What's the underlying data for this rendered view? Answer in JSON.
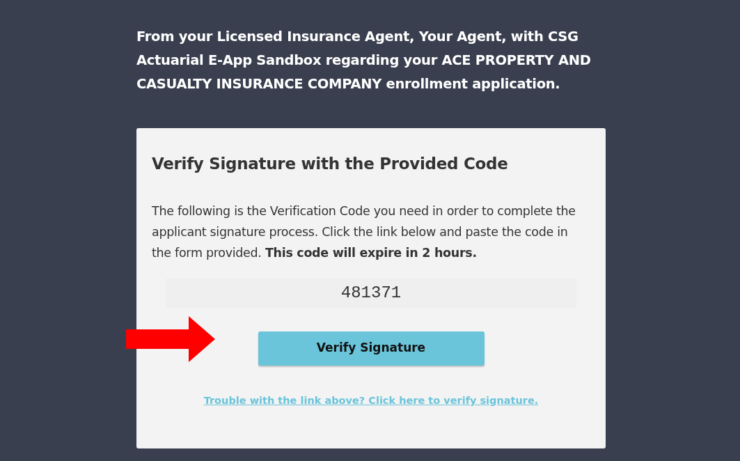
{
  "intro": "From your Licensed Insurance Agent, Your Agent, with CSG Actuarial E-App Sandbox regarding your ACE PROPERTY AND CASUALTY INSURANCE COMPANY enrollment application.",
  "card": {
    "title": "Verify Signature with the Provided Code",
    "message": "The following is the Verification Code you need in order to complete the applicant signature process. Click the link below and paste the code in the form provided. **This code will expire in 2 hours.**",
    "code": "481371",
    "button": "Verify Signature",
    "fallback_link": "Trouble with the link above? Click here to verify signature."
  }
}
